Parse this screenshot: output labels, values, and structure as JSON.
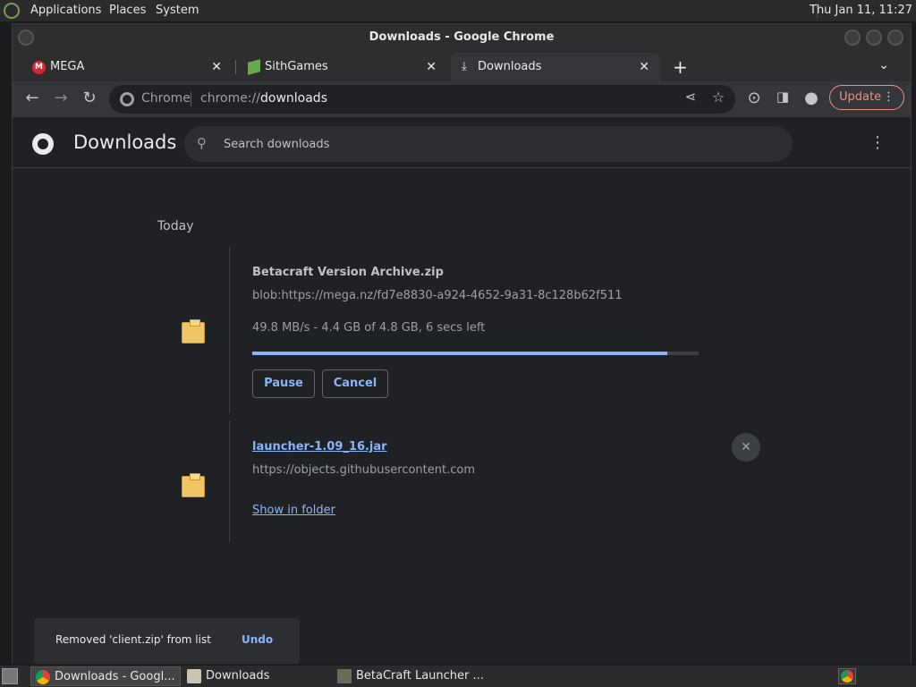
{
  "system_panel": {
    "menus": [
      "Applications",
      "Places",
      "System"
    ],
    "clock": "Thu Jan 11, 11:27"
  },
  "window": {
    "title": "Downloads - Google Chrome"
  },
  "tabs": [
    {
      "title": "MEGA",
      "favicon": "mega-icon",
      "active": false
    },
    {
      "title": "SithGames",
      "favicon": "sithgames-icon",
      "active": false
    },
    {
      "title": "Downloads",
      "favicon": "download-icon",
      "active": true
    }
  ],
  "toolbar": {
    "omnibox_chip": "Chrome",
    "url_scheme": "chrome://",
    "url_host": "downloads",
    "update_label": "Update"
  },
  "downloads_page": {
    "title": "Downloads",
    "search_placeholder": "Search downloads",
    "section_date": "Today",
    "items": [
      {
        "name": "Betacraft Version Archive.zip",
        "source": "blob:https://mega.nz/fd7e8830-a924-4652-9a31-8c128b62f511",
        "status": "49.8 MB/s - 4.4 GB of 4.8 GB, 6 secs left",
        "progress": 0.93,
        "actions": [
          "Pause",
          "Cancel"
        ]
      },
      {
        "name": "launcher-1.09_16.jar",
        "source": "https://objects.githubusercontent.com",
        "link": "Show in folder"
      }
    ]
  },
  "toast": {
    "message": "Removed 'client.zip' from list",
    "action": "Undo"
  },
  "taskbar": {
    "tasks": [
      {
        "label": "Downloads - Googl...",
        "icon": "chrome-icon",
        "active": true
      },
      {
        "label": "Downloads",
        "icon": "folder-icon",
        "active": false
      },
      {
        "label": "BetaCraft Launcher ...",
        "icon": "betacraft-icon",
        "active": false
      }
    ]
  },
  "colors": {
    "accent": "#8ab4f8",
    "update": "#f28b82",
    "background": "#202124"
  }
}
